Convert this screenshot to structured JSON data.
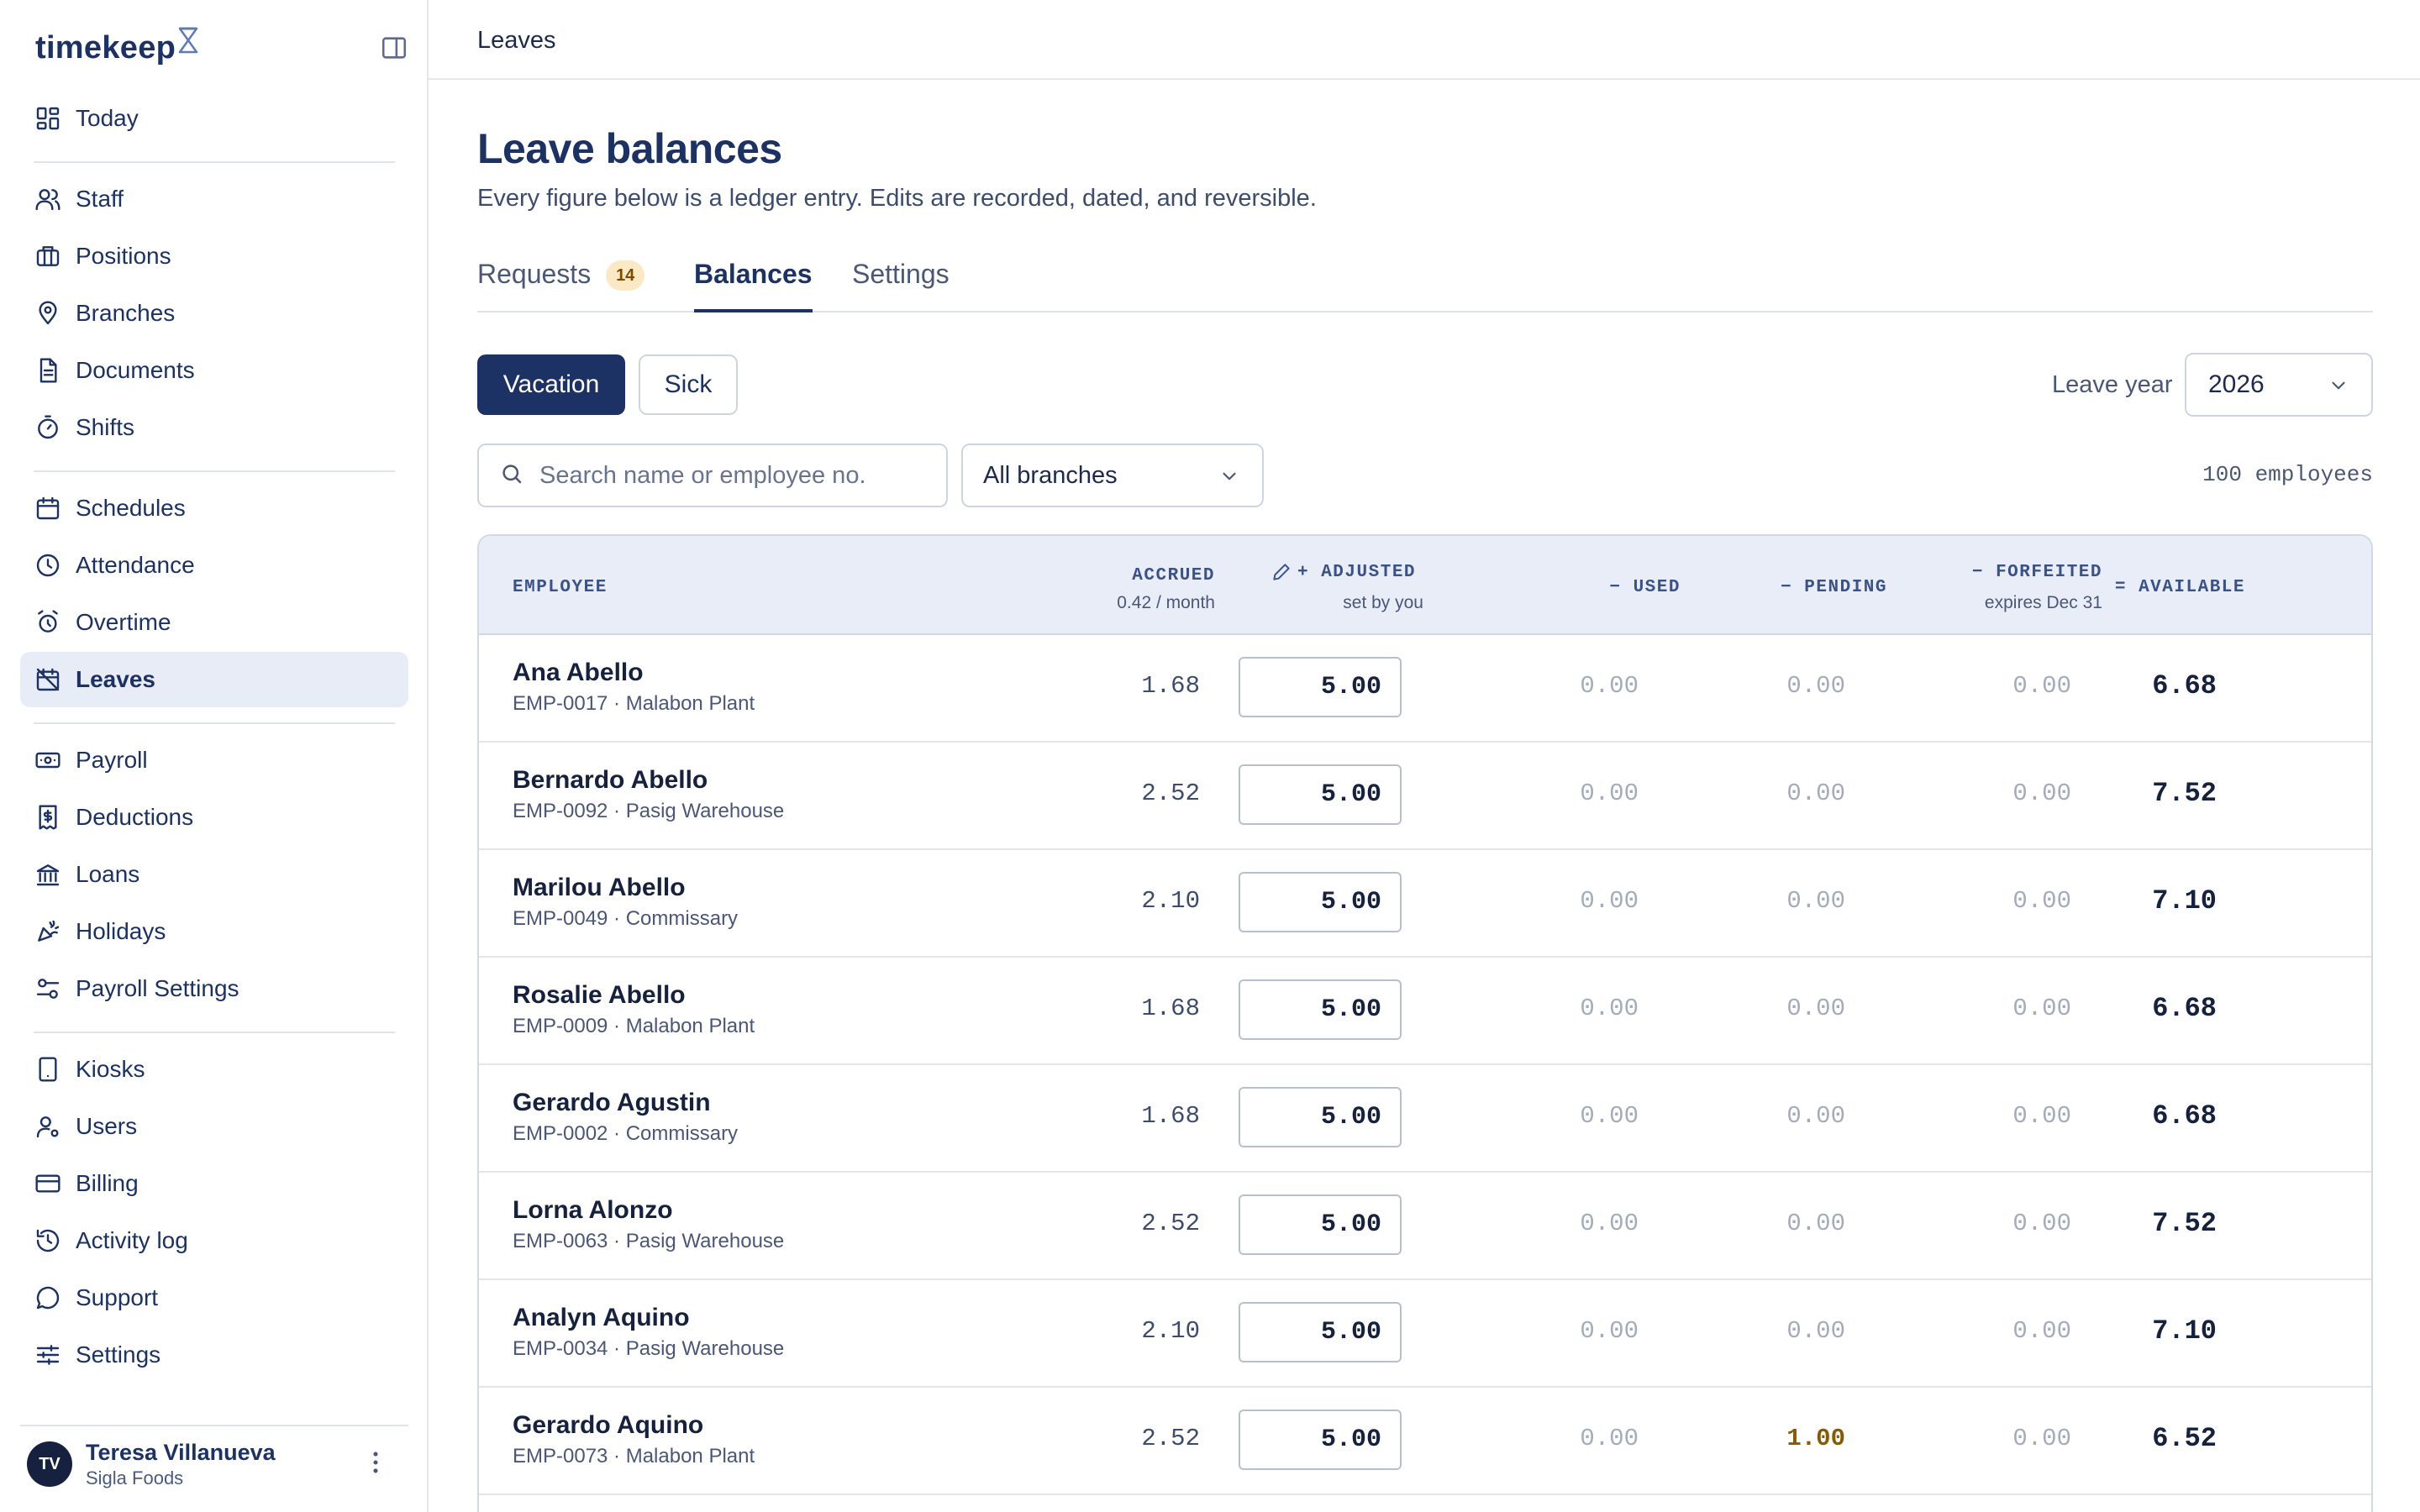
{
  "app": {
    "name": "timekeep"
  },
  "sidebar": {
    "groups": [
      [
        {
          "label": "Today",
          "icon": "dashboard-icon"
        }
      ],
      [
        {
          "label": "Staff",
          "icon": "users-icon"
        },
        {
          "label": "Positions",
          "icon": "briefcase-icon"
        },
        {
          "label": "Branches",
          "icon": "map-pin-icon"
        },
        {
          "label": "Documents",
          "icon": "document-icon"
        },
        {
          "label": "Shifts",
          "icon": "stopwatch-icon"
        }
      ],
      [
        {
          "label": "Schedules",
          "icon": "calendar-icon"
        },
        {
          "label": "Attendance",
          "icon": "clock-icon"
        },
        {
          "label": "Overtime",
          "icon": "alarm-icon"
        },
        {
          "label": "Leaves",
          "icon": "calendar-off-icon",
          "active": true
        }
      ],
      [
        {
          "label": "Payroll",
          "icon": "banknote-icon"
        },
        {
          "label": "Deductions",
          "icon": "receipt-icon"
        },
        {
          "label": "Loans",
          "icon": "bank-icon"
        },
        {
          "label": "Holidays",
          "icon": "party-icon"
        },
        {
          "label": "Payroll Settings",
          "icon": "sliders-toggle-icon"
        }
      ],
      [
        {
          "label": "Kiosks",
          "icon": "tablet-icon"
        },
        {
          "label": "Users",
          "icon": "user-cog-icon"
        },
        {
          "label": "Billing",
          "icon": "credit-card-icon"
        },
        {
          "label": "Activity log",
          "icon": "history-icon"
        },
        {
          "label": "Support",
          "icon": "chat-icon"
        },
        {
          "label": "Settings",
          "icon": "settings-sliders-icon"
        }
      ]
    ],
    "user": {
      "initials": "TV",
      "name": "Teresa Villanueva",
      "org": "Sigla Foods"
    }
  },
  "topbar": {
    "breadcrumb": "Leaves"
  },
  "page": {
    "title": "Leave balances",
    "subtitle": "Every figure below is a ledger entry. Edits are recorded, dated, and reversible."
  },
  "tabs": [
    {
      "label": "Requests",
      "badge": "14"
    },
    {
      "label": "Balances",
      "active": true
    },
    {
      "label": "Settings"
    }
  ],
  "leave_types": {
    "vacation": "Vacation",
    "sick": "Sick",
    "selected": "Vacation"
  },
  "year": {
    "label": "Leave year",
    "value": "2026"
  },
  "filters": {
    "search_placeholder": "Search name or employee no.",
    "branch": "All branches",
    "count": "100 employees"
  },
  "table": {
    "headers": {
      "employee": "EMPLOYEE",
      "accrued": "ACCRUED",
      "accrued_sub": "0.42 / month",
      "adjusted": "+ ADJUSTED",
      "adjusted_sub": "set by you",
      "used": "− USED",
      "pending": "− PENDING",
      "forfeited": "− FORFEITED",
      "forfeited_sub": "expires Dec 31",
      "available": "= AVAILABLE"
    },
    "rows": [
      {
        "name": "Ana Abello",
        "meta": "EMP-0017 · Malabon Plant",
        "accrued": "1.68",
        "adjusted": "5.00",
        "used": "0.00",
        "pending": "0.00",
        "forfeited": "0.00",
        "available": "6.68"
      },
      {
        "name": "Bernardo Abello",
        "meta": "EMP-0092 · Pasig Warehouse",
        "accrued": "2.52",
        "adjusted": "5.00",
        "used": "0.00",
        "pending": "0.00",
        "forfeited": "0.00",
        "available": "7.52"
      },
      {
        "name": "Marilou Abello",
        "meta": "EMP-0049 · Commissary",
        "accrued": "2.10",
        "adjusted": "5.00",
        "used": "0.00",
        "pending": "0.00",
        "forfeited": "0.00",
        "available": "7.10"
      },
      {
        "name": "Rosalie Abello",
        "meta": "EMP-0009 · Malabon Plant",
        "accrued": "1.68",
        "adjusted": "5.00",
        "used": "0.00",
        "pending": "0.00",
        "forfeited": "0.00",
        "available": "6.68"
      },
      {
        "name": "Gerardo Agustin",
        "meta": "EMP-0002 · Commissary",
        "accrued": "1.68",
        "adjusted": "5.00",
        "used": "0.00",
        "pending": "0.00",
        "forfeited": "0.00",
        "available": "6.68"
      },
      {
        "name": "Lorna Alonzo",
        "meta": "EMP-0063 · Pasig Warehouse",
        "accrued": "2.52",
        "adjusted": "5.00",
        "used": "0.00",
        "pending": "0.00",
        "forfeited": "0.00",
        "available": "7.52"
      },
      {
        "name": "Analyn Aquino",
        "meta": "EMP-0034 · Pasig Warehouse",
        "accrued": "2.10",
        "adjusted": "5.00",
        "used": "0.00",
        "pending": "0.00",
        "forfeited": "0.00",
        "available": "7.10"
      },
      {
        "name": "Gerardo Aquino",
        "meta": "EMP-0073 · Malabon Plant",
        "accrued": "2.52",
        "adjusted": "5.00",
        "used": "0.00",
        "pending": "1.00",
        "forfeited": "0.00",
        "available": "6.52",
        "pending_highlight": true
      }
    ]
  },
  "colors": {
    "brand": "#1d3264",
    "header_bg": "#e8edf7",
    "active_nav": "#e7ecf6",
    "badge_bg": "#fbe9c6",
    "pending": "#8a5a00"
  }
}
